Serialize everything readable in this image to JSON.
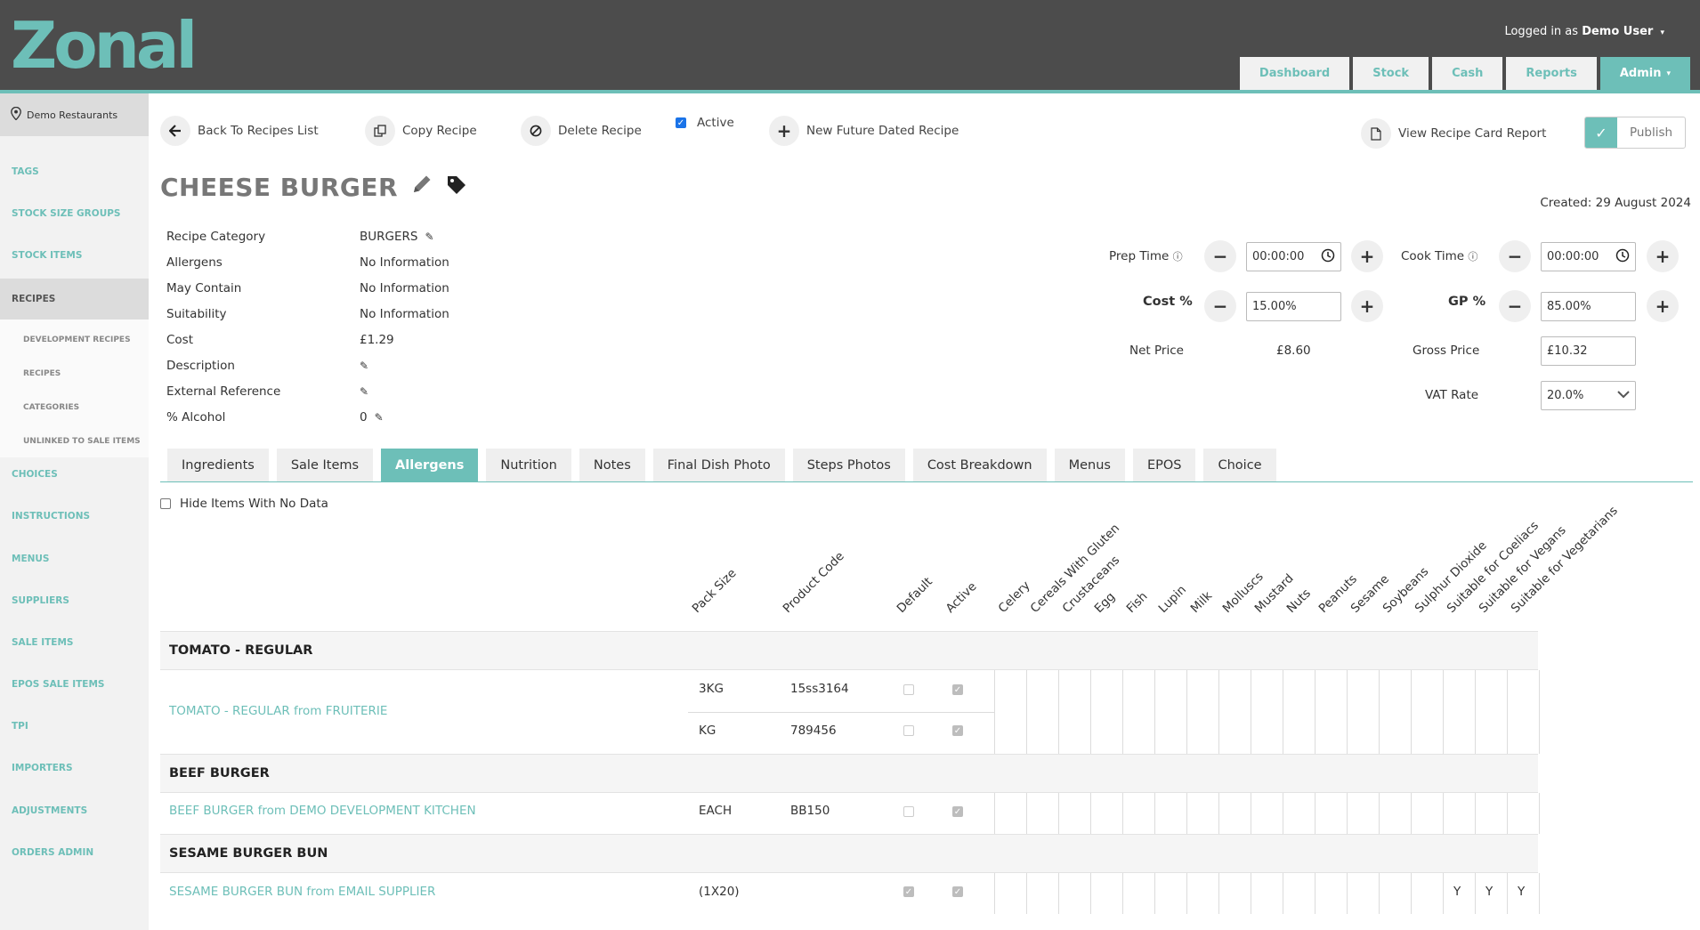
{
  "header": {
    "logo": "Zonal",
    "logged_in_prefix": "Logged in as",
    "user_name": "Demo User",
    "nav": [
      "Dashboard",
      "Stock",
      "Cash",
      "Reports",
      "Admin"
    ],
    "accent": "#6dbfb8"
  },
  "sidebar": {
    "location": "Demo Restaurants",
    "items": [
      "TAGS",
      "STOCK SIZE GROUPS",
      "STOCK ITEMS",
      "RECIPES",
      "CHOICES",
      "INSTRUCTIONS",
      "MENUS",
      "SUPPLIERS",
      "SALE ITEMS",
      "EPOS SALE ITEMS",
      "TPI",
      "IMPORTERS",
      "ADJUSTMENTS",
      "ORDERS ADMIN"
    ],
    "sub_items": [
      "DEVELOPMENT RECIPES",
      "RECIPES",
      "CATEGORIES",
      "UNLINKED TO SALE ITEMS"
    ]
  },
  "toolbar": {
    "back": "Back To Recipes List",
    "copy": "Copy Recipe",
    "delete": "Delete Recipe",
    "active": "Active",
    "new_future": "New Future Dated Recipe",
    "view_report": "View Recipe Card Report",
    "publish": "Publish"
  },
  "recipe": {
    "title": "CHEESE BURGER",
    "created": "Created: 29 August 2024",
    "fields": [
      {
        "label": "Recipe Category",
        "value": "BURGERS"
      },
      {
        "label": "Allergens",
        "value": "No Information"
      },
      {
        "label": "May Contain",
        "value": "No Information"
      },
      {
        "label": "Suitability",
        "value": "No Information"
      },
      {
        "label": "Cost",
        "value": "£1.29"
      },
      {
        "label": "Description",
        "value": ""
      },
      {
        "label": "External Reference",
        "value": ""
      },
      {
        "label": "% Alcohol",
        "value": "0"
      }
    ]
  },
  "pricing": {
    "prep_time_label": "Prep Time",
    "prep_time": "00:00:00",
    "cook_time_label": "Cook Time",
    "cook_time": "00:00:00",
    "cost_pct_label": "Cost %",
    "cost_pct": "15.00%",
    "gp_pct_label": "GP %",
    "gp_pct": "85.00%",
    "net_price_label": "Net Price",
    "net_price": "£8.60",
    "gross_price_label": "Gross Price",
    "gross_price": "£10.32",
    "vat_rate_label": "VAT Rate",
    "vat_rate": "20.0%"
  },
  "tabs": [
    "Ingredients",
    "Sale Items",
    "Allergens",
    "Nutrition",
    "Notes",
    "Final Dish Photo",
    "Steps Photos",
    "Cost Breakdown",
    "Menus",
    "EPOS",
    "Choice"
  ],
  "active_tab": "Allergens",
  "hide_label": "Hide Items With No Data",
  "columns": {
    "pack_size": "Pack Size",
    "product_code": "Product Code",
    "default": "Default",
    "active": "Active",
    "allergens": [
      "Celery",
      "Cereals With Gluten",
      "Crustaceans",
      "Egg",
      "Fish",
      "Lupin",
      "Milk",
      "Molluscs",
      "Mustard",
      "Nuts",
      "Peanuts",
      "Sesame",
      "Soybeans",
      "Sulphur Dioxide",
      "Suitable for Coeliacs",
      "Suitable for Vegans",
      "Suitable for Vegetarians"
    ]
  },
  "groups": [
    {
      "name": "TOMATO - REGULAR",
      "ingredient": "TOMATO - REGULAR from FRUITERIE",
      "rows": [
        {
          "pack": "3KG",
          "code": "15ss3164",
          "default": false,
          "active": true
        },
        {
          "pack": "KG",
          "code": "789456",
          "default": false,
          "active": true
        }
      ],
      "marks": []
    },
    {
      "name": "BEEF BURGER",
      "ingredient": "BEEF BURGER from DEMO DEVELOPMENT KITCHEN",
      "rows": [
        {
          "pack": "EACH",
          "code": "BB150",
          "default": false,
          "active": true
        }
      ],
      "marks": []
    },
    {
      "name": "SESAME BURGER BUN",
      "ingredient": "SESAME BURGER BUN from EMAIL SUPPLIER",
      "rows": [
        {
          "pack": "(1X20)",
          "code": "",
          "default": true,
          "active": true
        }
      ],
      "marks": [
        "Y",
        "Y",
        "Y"
      ]
    }
  ]
}
